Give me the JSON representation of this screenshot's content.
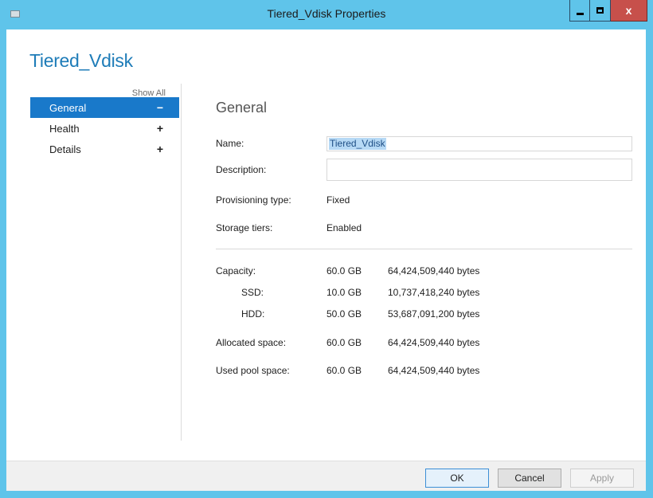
{
  "window": {
    "title": "Tiered_Vdisk Properties",
    "close_glyph": "x"
  },
  "heading": "Tiered_Vdisk",
  "nav": {
    "show_all": "Show All",
    "items": [
      {
        "label": "General",
        "sign": "−",
        "selected": true
      },
      {
        "label": "Health",
        "sign": "+",
        "selected": false
      },
      {
        "label": "Details",
        "sign": "+",
        "selected": false
      }
    ]
  },
  "general": {
    "section_title": "General",
    "name_label": "Name:",
    "name_value": "Tiered_Vdisk",
    "description_label": "Description:",
    "description_value": "",
    "provisioning_label": "Provisioning type:",
    "provisioning_value": "Fixed",
    "tiers_label": "Storage tiers:",
    "tiers_value": "Enabled",
    "capacity": [
      {
        "label": "Capacity:",
        "size": "60.0 GB",
        "bytes": "64,424,509,440 bytes"
      },
      {
        "label": "SSD:",
        "size": "10.0 GB",
        "bytes": "10,737,418,240 bytes"
      },
      {
        "label": "HDD:",
        "size": "50.0 GB",
        "bytes": "53,687,091,200 bytes"
      },
      {
        "label": "Allocated space:",
        "size": "60.0 GB",
        "bytes": "64,424,509,440 bytes"
      },
      {
        "label": "Used pool space:",
        "size": "60.0 GB",
        "bytes": "64,424,509,440 bytes"
      }
    ]
  },
  "buttons": {
    "ok": "OK",
    "cancel": "Cancel",
    "apply": "Apply"
  },
  "colors": {
    "titlebar": "#5fc4ea",
    "accent": "#1979ca",
    "heading": "#1e7cb8",
    "close": "#c7504b"
  }
}
